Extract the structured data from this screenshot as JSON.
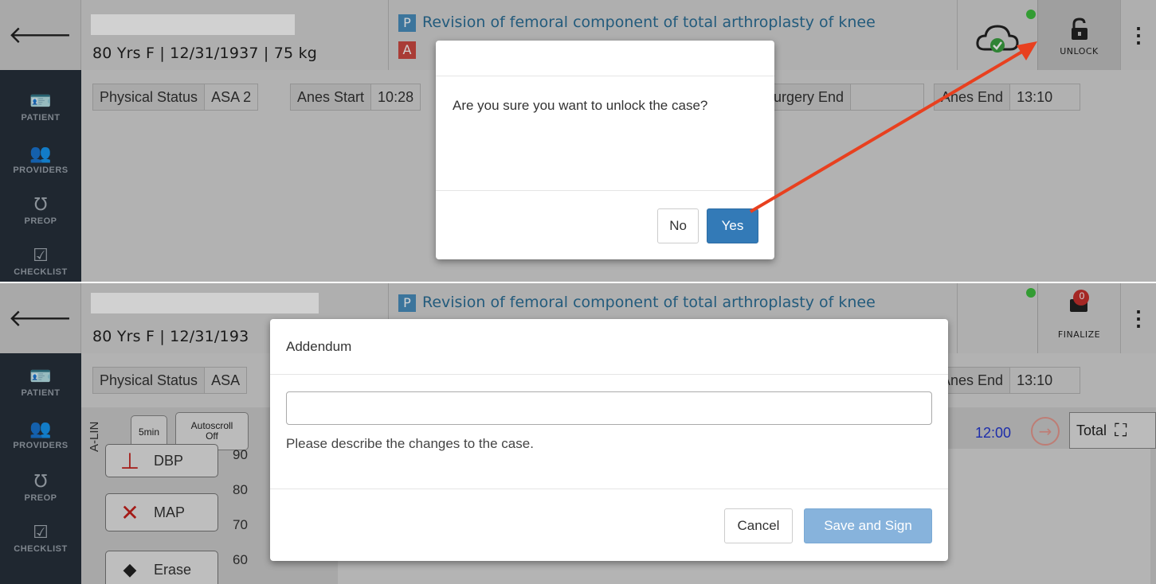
{
  "panel1": {
    "header": {
      "patient_info": "80 Yrs F | 12/31/1937 | 75 kg",
      "procedure_badge_primary": "P",
      "procedure_badge_secondary": "A",
      "procedure_title": "Revision of femoral component of total arthroplasty of knee",
      "action_label": "UNLOCK",
      "menu_glyph": "⋮"
    },
    "sidebar": [
      {
        "label": "PATIENT",
        "icon": "patient-id-icon"
      },
      {
        "label": "PROVIDERS",
        "icon": "providers-icon"
      },
      {
        "label": "PREOP",
        "icon": "stethoscope-icon"
      },
      {
        "label": "CHECKLIST",
        "icon": "checklist-icon"
      }
    ],
    "status": {
      "physical_status_label": "Physical Status",
      "physical_status_value": "ASA 2",
      "anes_start_label": "Anes Start",
      "anes_start_value": "10:28",
      "surgery_end_label": "urgery End",
      "surgery_end_value": "",
      "anes_end_label": "Anes End",
      "anes_end_value": "13:10"
    },
    "modal": {
      "message": "Are you sure you want to unlock the case?",
      "no_label": "No",
      "yes_label": "Yes"
    },
    "annotation_color": "#e8401f"
  },
  "panel2": {
    "header": {
      "patient_info": "80 Yrs F | 12/31/193",
      "procedure_badge_primary": "P",
      "procedure_title": "Revision of femoral component of total arthroplasty of knee",
      "action_label": "FINALIZE",
      "notification_count": "0",
      "menu_glyph": "⋮"
    },
    "sidebar": [
      {
        "label": "PATIENT",
        "icon": "patient-id-icon"
      },
      {
        "label": "PROVIDERS",
        "icon": "providers-icon"
      },
      {
        "label": "PREOP",
        "icon": "stethoscope-icon"
      },
      {
        "label": "CHECKLIST",
        "icon": "checklist-icon"
      }
    ],
    "status": {
      "physical_status_label": "Physical Status",
      "physical_status_value": "ASA",
      "anes_end_label": "Anes End",
      "anes_end_value": "13:10"
    },
    "chart_toolbar": {
      "interval_label": "5min",
      "autoscroll_label": "Autoscroll",
      "autoscroll_state": "Off",
      "time_label": "12:00",
      "total_label": "Total",
      "side_label": "A-LIN"
    },
    "legend": [
      {
        "label": "DBP",
        "glyph": "⊥",
        "color": "#c8221d"
      },
      {
        "label": "MAP",
        "glyph": "✕",
        "color": "#c8221d"
      },
      {
        "label": "Erase",
        "glyph": "◆",
        "color": "#222222"
      }
    ],
    "y_ticks": [
      "90",
      "80",
      "70",
      "60"
    ],
    "modal": {
      "title": "Addendum",
      "input_value": "",
      "help_text": "Please describe the changes to the case.",
      "cancel_label": "Cancel",
      "save_label": "Save and Sign"
    }
  }
}
